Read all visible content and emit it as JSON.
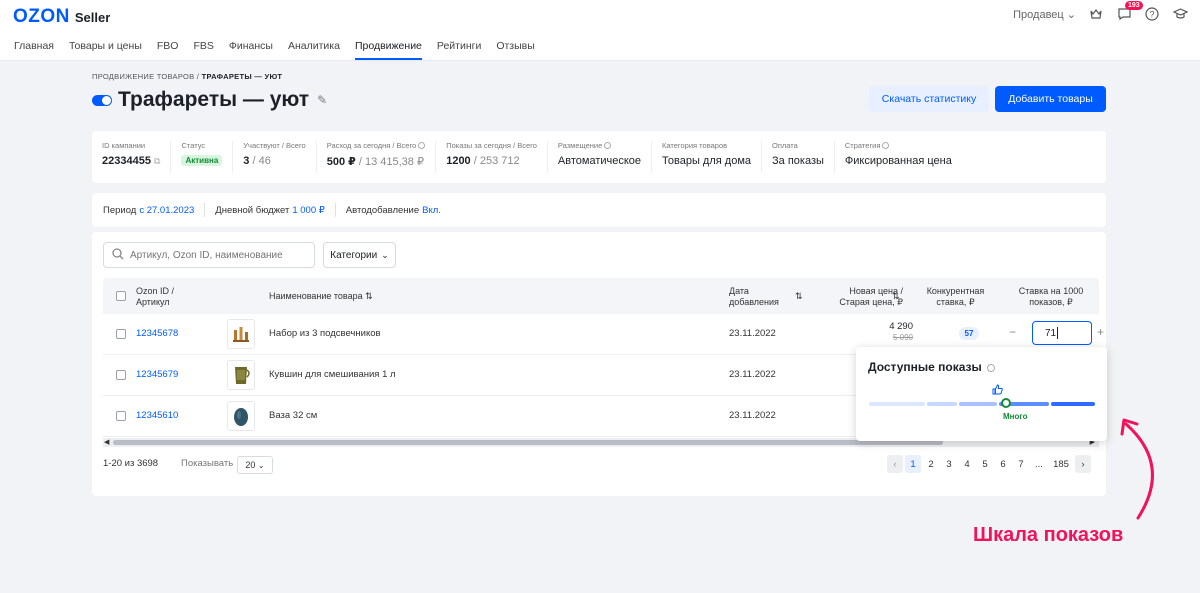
{
  "app": {
    "logo_ozon": "OZON",
    "logo_seller": "Seller",
    "account": "Продавец",
    "notifications": "193"
  },
  "nav": [
    "Главная",
    "Товары и цены",
    "FBO",
    "FBS",
    "Финансы",
    "Аналитика",
    "Продвижение",
    "Рейтинги",
    "Отзывы"
  ],
  "nav_active": "Продвижение",
  "breadcrumb": {
    "parent": "ПРОДВИЖЕНИЕ ТОВАРОВ",
    "sep": "/",
    "current": "ТРАФАРЕТЫ — УЮТ"
  },
  "page_title": "Трафареты — уют",
  "buttons": {
    "download": "Скачать статистику",
    "add": "Добавить товары"
  },
  "stats": [
    {
      "label": "ID кампании",
      "value": "22334455"
    },
    {
      "label": "Статус",
      "value": "Активна"
    },
    {
      "label": "Участвуют / Всего",
      "value": "3",
      "muted": "/ 46"
    },
    {
      "label": "Расход за сегодня / Всего",
      "value": "500 ₽",
      "muted": "/ 13 415,38 ₽"
    },
    {
      "label": "Показы за сегодня / Всего",
      "value": "1200",
      "muted": "/ 253 712"
    },
    {
      "label": "Размещение",
      "value": "Автоматическое"
    },
    {
      "label": "Категория товаров",
      "value": "Товары для дома"
    },
    {
      "label": "Оплата",
      "value": "За показы"
    },
    {
      "label": "Стратегия",
      "value": "Фиксированная цена"
    }
  ],
  "period": {
    "label": "Период",
    "value": "с 27.01.2023",
    "budget_label": "Дневной бюджет",
    "budget": "1 000 ₽",
    "auto_label": "Автодобавление",
    "auto": "Вкл."
  },
  "search": {
    "placeholder": "Артикул, Ozon ID, наименование"
  },
  "filter": {
    "label": "Категории"
  },
  "table": {
    "headers": {
      "id": "Ozon ID / Артикул",
      "name": "Наименование товара",
      "date": "Дата добавления",
      "price": "Новая цена / Старая цена, ₽",
      "competitive": "Конкурентная ставка, ₽",
      "bid": "Ставка на 1000 показов, ₽"
    },
    "rows": [
      {
        "sku": "12345678",
        "name": "Набор из 3 подсвечников",
        "date": "23.11.2022",
        "price": "4 290",
        "old_price": "5 090",
        "competitive": "57",
        "bid": "71"
      },
      {
        "sku": "12345679",
        "name": "Кувшин для смешивания 1 л",
        "date": "23.11.2022"
      },
      {
        "sku": "12345610",
        "name": "Ваза 32 см",
        "date": "23.11.2022"
      }
    ]
  },
  "footer": {
    "range": "1-20 из 3698",
    "show_label": "Показывать",
    "per_page": "20",
    "pages": [
      "1",
      "2",
      "3",
      "4",
      "5",
      "6",
      "7",
      "...",
      "185"
    ],
    "active_page": "1"
  },
  "popover": {
    "title": "Доступные показы",
    "level_label": "Много",
    "level": 0.62
  },
  "annotation": "Шкала показов",
  "colors": {
    "brand": "#005bff",
    "accent": "#f0125a",
    "success": "#138a36"
  }
}
